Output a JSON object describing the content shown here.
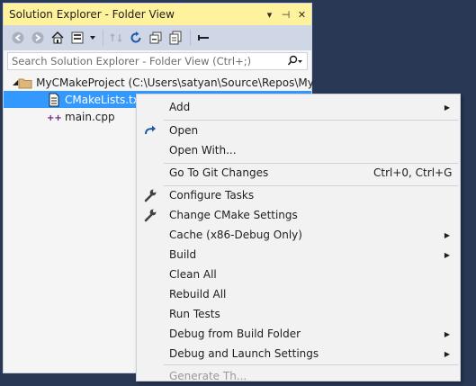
{
  "panel": {
    "title": "Solution Explorer - Folder View",
    "title_buttons": [
      "▾",
      "⊣",
      "✕"
    ]
  },
  "toolbar": {
    "icons": [
      "back-icon",
      "forward-icon",
      "home-icon",
      "switch-views-icon",
      "dropdown-icon",
      "sync-icon",
      "refresh-icon",
      "collapse-all-icon",
      "copy-icon",
      "properties-icon"
    ]
  },
  "search": {
    "placeholder": "Search Solution Explorer - Folder View (Ctrl+;)"
  },
  "tree": {
    "root_label": "MyCMakeProject (C:\\Users\\satyan\\Source\\Repos\\My",
    "items": [
      {
        "label": "CMakeLists.txt",
        "selected": true,
        "icon": "document-icon"
      },
      {
        "label": "main.cpp",
        "selected": false,
        "icon": "cpp-file-icon"
      }
    ]
  },
  "context_menu": {
    "items": [
      {
        "label": "Add",
        "shortcut": "",
        "submenu": true,
        "icon": ""
      },
      {
        "label": "Open",
        "shortcut": "",
        "submenu": false,
        "icon": "open-arrow-icon"
      },
      {
        "label": "Open With...",
        "shortcut": "",
        "submenu": false,
        "icon": ""
      },
      {
        "label": "Go To Git Changes",
        "shortcut": "Ctrl+0, Ctrl+G",
        "submenu": false,
        "icon": ""
      },
      {
        "label": "Configure Tasks",
        "shortcut": "",
        "submenu": false,
        "icon": "wrench-icon"
      },
      {
        "label": "Change CMake Settings",
        "shortcut": "",
        "submenu": false,
        "icon": "wrench-icon"
      },
      {
        "label": "Cache (x86-Debug Only)",
        "shortcut": "",
        "submenu": true,
        "icon": ""
      },
      {
        "label": "Build",
        "shortcut": "",
        "submenu": true,
        "icon": ""
      },
      {
        "label": "Clean All",
        "shortcut": "",
        "submenu": false,
        "icon": ""
      },
      {
        "label": "Rebuild All",
        "shortcut": "",
        "submenu": false,
        "icon": ""
      },
      {
        "label": "Run Tests",
        "shortcut": "",
        "submenu": false,
        "icon": ""
      },
      {
        "label": "Debug from Build Folder",
        "shortcut": "",
        "submenu": true,
        "icon": ""
      },
      {
        "label": "Debug and Launch Settings",
        "shortcut": "",
        "submenu": true,
        "icon": ""
      },
      {
        "label": "Generate Th...",
        "shortcut": "",
        "submenu": false,
        "icon": ""
      }
    ],
    "arrow_glyph": "▶"
  },
  "colors": {
    "background": "#293955",
    "title_bar": "#fff29d",
    "selection": "#3399ff",
    "menu_bg": "#f2f2f2"
  }
}
